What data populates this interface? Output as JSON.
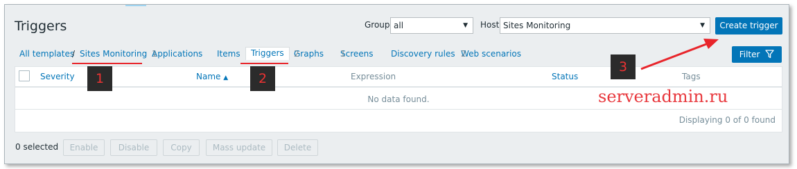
{
  "page": {
    "title": "Triggers"
  },
  "filters": {
    "group_label": "Group",
    "group_value": "all",
    "host_label": "Host",
    "host_value": "Sites Monitoring"
  },
  "buttons": {
    "create_trigger": "Create trigger",
    "filter": "Filter"
  },
  "nav": {
    "all_templates": "All templates",
    "separator": "/",
    "host": "Sites Monitoring",
    "applications": {
      "label": "Applications",
      "count": "1"
    },
    "items": "Items",
    "triggers": "Triggers",
    "graphs": {
      "label": "Graphs",
      "count": "2"
    },
    "screens": {
      "label": "Screens",
      "count": "1"
    },
    "discovery_rules": "Discovery rules",
    "web_scenarios": {
      "label": "Web scenarios",
      "count": "2"
    }
  },
  "table": {
    "columns": {
      "severity": "Severity",
      "name": "Name",
      "name_sort_indicator": "▲",
      "expression": "Expression",
      "status": "Status",
      "tags": "Tags"
    },
    "empty_message": "No data found.",
    "displaying": "Displaying 0 of 0 found"
  },
  "footer": {
    "selected": "0 selected",
    "actions": [
      "Enable",
      "Disable",
      "Copy",
      "Mass update",
      "Delete"
    ]
  },
  "annotations": {
    "marker_1": "1",
    "marker_2": "2",
    "marker_3": "3",
    "watermark": "serveradmin.ru"
  },
  "colors": {
    "accent": "#0275b8",
    "annotation_red": "#e8252b",
    "background": "#ebeef0"
  },
  "icons": {
    "filter": "funnel-icon",
    "dropdown": "caret-down-icon"
  }
}
